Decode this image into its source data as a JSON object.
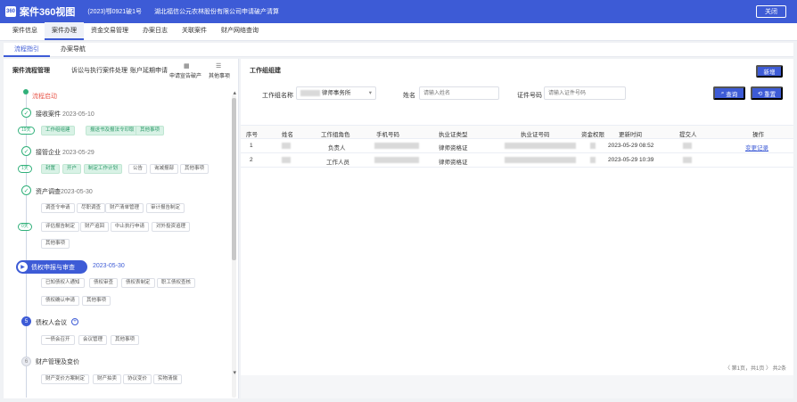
{
  "header": {
    "logo_text": "360",
    "title": "案件360视图",
    "case_no": "(2023)鄂0921破1号",
    "company": "湖北福信公元农林股份有限公司申请破产清算",
    "close_label": "关闭"
  },
  "main_tabs": [
    "案件信息",
    "案件办理",
    "资金交易管理",
    "办案日志",
    "关联案件",
    "财产网络查询"
  ],
  "sub_tabs": [
    "流程指引",
    "办案导航"
  ],
  "left_panel": {
    "title": "案件流程管理",
    "actions": [
      "诉讼与执行案件处理",
      "账户延期申请"
    ],
    "icon_actions": [
      {
        "icon": "building-icon",
        "label": "申请宣告破产"
      },
      {
        "icon": "list-icon",
        "label": "其他事项"
      }
    ],
    "start_label": "流程启动",
    "stages": [
      {
        "name": "接收案件",
        "date": "2023-05-10",
        "days": "19天",
        "chips": [
          "工作组组建",
          "报送书及报法令印取",
          "其他事项"
        ]
      },
      {
        "name": "接管企业",
        "date": "2023-05-29",
        "days": "1天",
        "chips": [
          "封置",
          "开户",
          "制定工作计划",
          "公告",
          "询减报部",
          "其他事项"
        ]
      },
      {
        "name": "资产调查",
        "date": "2023-05-30",
        "days": "0天",
        "chips": [
          "调查令申请",
          "尽职调查",
          "财产清单管理",
          "审计报告制定",
          "评估报告制定",
          "财产追回",
          "中止执行申请",
          "对外投资追理",
          "其他事项"
        ]
      },
      {
        "name": "债权申报与审查",
        "date": "2023-05-30",
        "chips": [
          "已知债权人通知",
          "债权审查",
          "债权表制定",
          "职工债权查核",
          "债权确认申请",
          "其他事项"
        ]
      },
      {
        "name": "债权人会议",
        "num": "5",
        "chips": [
          "一债会召开",
          "会议管理",
          "其他事项"
        ]
      },
      {
        "name": "财产管理及变价",
        "num": "6",
        "chips": [
          "财产变价方案制定",
          "财产拍卖",
          "协议变价",
          "实物清偿"
        ]
      }
    ]
  },
  "right_panel": {
    "title": "工作组组建",
    "add_label": "新增",
    "filters": {
      "group_label": "工作组名称",
      "group_value": "律师事务所",
      "name_label": "姓名",
      "name_placeholder": "请输入姓名",
      "cert_label": "证件号码",
      "cert_placeholder": "请输入证件号码",
      "search_label": "查询",
      "reset_label": "重置"
    },
    "columns": [
      "序号",
      "姓名",
      "工作组角色",
      "手机号码",
      "执业证类型",
      "执业证号码",
      "资金权限",
      "更新时间",
      "提交人",
      "操作"
    ],
    "rows": [
      {
        "idx": "1",
        "role": "负责人",
        "cert_type": "律师资格证",
        "updated": "2023-05-29 08:52",
        "action": "变更记录"
      },
      {
        "idx": "2",
        "role": "工作人员",
        "cert_type": "律师资格证",
        "updated": "2023-05-29 10:39",
        "action": ""
      }
    ],
    "pager": "〈  第1页，共1页  〉  共2条"
  }
}
